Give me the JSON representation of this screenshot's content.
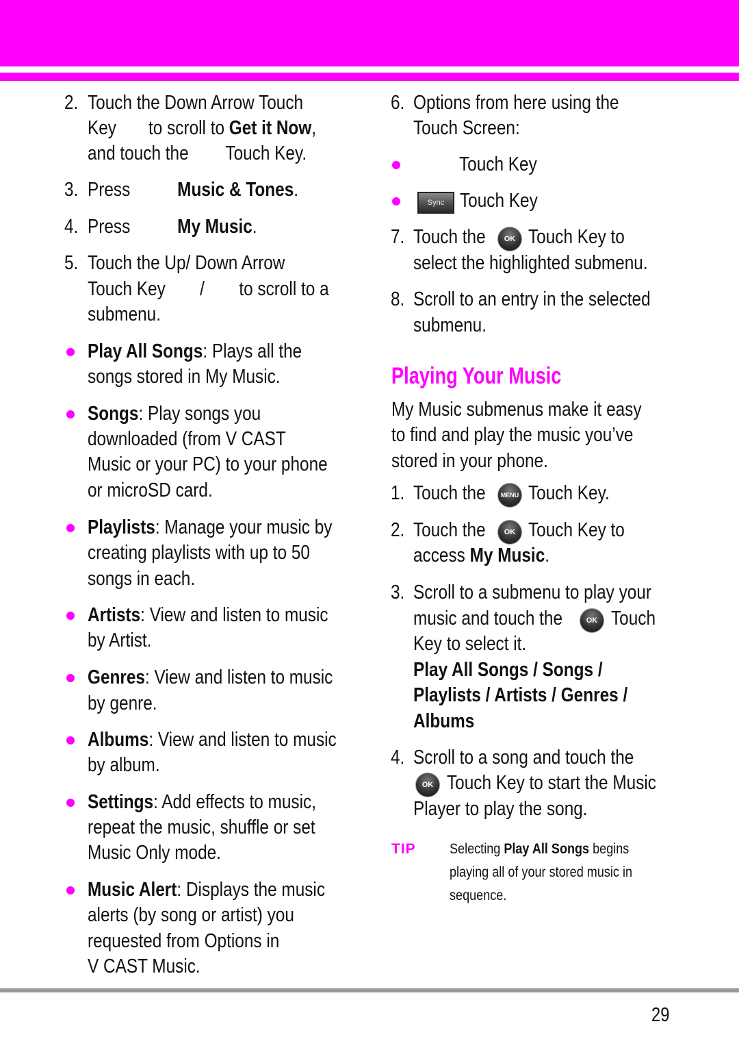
{
  "page": {
    "number": "29",
    "accent_color": "#ff00ff",
    "rule_color": "#9a9a9a"
  },
  "left": {
    "step2": {
      "num": "2.",
      "l1": "Touch the Down Arrow Touch",
      "l2a": "Key",
      "l2b": "to scroll to ",
      "l2c": "Get it Now",
      "l2d": ",",
      "l3a": "and touch the",
      "l3b": "Touch Key."
    },
    "step3": {
      "num": "3.",
      "a": "Press",
      "b": "Music & Tones",
      "c": "."
    },
    "step4": {
      "num": "4.",
      "a": "Press",
      "b": "My Music",
      "c": "."
    },
    "step5": {
      "num": "5.",
      "l1": "Touch the Up/ Down Arrow",
      "l2a": "Touch Key",
      "l2b": "/",
      "l2c": "to scroll to a",
      "l3": "submenu."
    },
    "bullets": [
      {
        "term": "Play All Songs",
        "lines": [
          ": Plays all the",
          "songs stored in My Music."
        ]
      },
      {
        "term": "Songs",
        "lines": [
          ": Play songs you",
          "downloaded (from V CAST",
          "Music or your PC) to your phone",
          "or microSD card."
        ]
      },
      {
        "term": "Playlists",
        "lines": [
          ": Manage your music by",
          "creating playlists with up to 50",
          "songs in each."
        ]
      },
      {
        "term": "Artists",
        "lines": [
          ": View and listen to music",
          "by Artist."
        ]
      },
      {
        "term": "Genres",
        "lines": [
          ": View and listen to music",
          "by genre."
        ]
      },
      {
        "term": "Albums",
        "lines": [
          ": View and listen to music",
          "by album."
        ]
      },
      {
        "term": "Settings",
        "lines": [
          ": Add effects to music,",
          "repeat the music, shuffle or set",
          "Music Only mode."
        ]
      },
      {
        "term": "Music Alert",
        "lines": [
          ": Displays the music",
          "alerts (by song or artist) you",
          "requested from Options in",
          "V CAST Music."
        ]
      }
    ]
  },
  "right": {
    "step6": {
      "num": "6.",
      "l1": "Options from here using the",
      "l2": "Touch Screen:"
    },
    "bullet_keys": [
      {
        "label": "Touch Key"
      },
      {
        "icon_label": "Sync",
        "label": "Touch Key"
      }
    ],
    "step7": {
      "num": "7.",
      "l1a": "Touch the",
      "icon": "OK",
      "l1b": "Touch Key to",
      "l2": "select the highlighted submenu."
    },
    "step8": {
      "num": "8.",
      "l1": "Scroll to an entry in the selected",
      "l2": "submenu."
    },
    "section_title": "Playing Your Music",
    "intro": [
      "My Music submenus make it easy",
      "to find and play the music you’ve",
      "stored in your phone."
    ],
    "s1": {
      "num": "1.",
      "a": "Touch the",
      "icon": "MENU",
      "b": "Touch Key."
    },
    "s2": {
      "num": "2.",
      "a": "Touch the",
      "icon": "OK",
      "b": "Touch Key to",
      "l2a": "access ",
      "l2b": "My Music",
      "l2c": "."
    },
    "s3": {
      "num": "3.",
      "l1": "Scroll to a submenu to play your",
      "l2a": "music and touch the",
      "icon": "OK",
      "l2b": "Touch",
      "l3": "Key to select it.",
      "bold_lines": [
        "Play All Songs / Songs /",
        "Playlists / Artists / Genres /",
        "Albums"
      ]
    },
    "s4": {
      "num": "4.",
      "l1": "Scroll to a song and touch the",
      "icon": "OK",
      "l2": "Touch Key to start the Music",
      "l3": "Player to play the song."
    },
    "tip": {
      "label": "TIP",
      "l1a": "Selecting ",
      "l1b": "Play All Songs",
      "l1c": " begins",
      "l2": "playing all of your stored music in",
      "l3": "sequence."
    }
  }
}
